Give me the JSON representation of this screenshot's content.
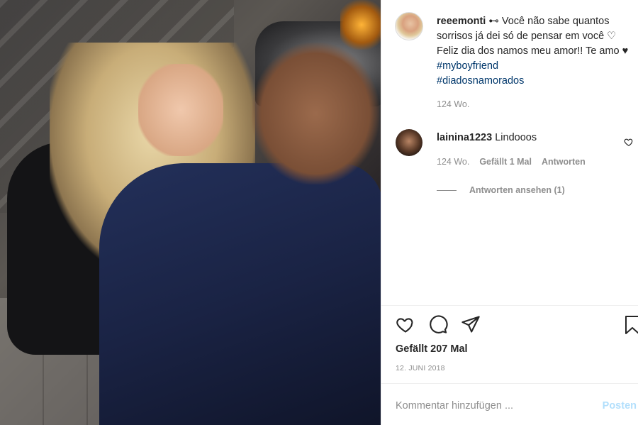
{
  "post": {
    "username": "reeemonti",
    "caption_text": "⊷ Você não sabe quantos sorrisos já dei só de pensar em você ♡ Feliz dia dos namos meu amor!! Te amo ♥ ",
    "hashtag_1": "#myboyfriend",
    "hashtag_2": "#diadosnamorados",
    "time_ago": "124 Wo."
  },
  "comment": {
    "username": "lainina1223",
    "text": "Lindooos",
    "time_ago": "124 Wo.",
    "likes_label": "Gefällt 1 Mal",
    "reply_label": "Antworten",
    "view_replies_label": "Antworten ansehen (1)"
  },
  "engagement": {
    "likes_label": "Gefällt 207 Mal",
    "date": "12. JUNI 2018"
  },
  "input": {
    "placeholder": "Kommentar hinzufügen ...",
    "post_label": "Posten"
  },
  "icons": {
    "like": "heart-icon",
    "comment": "comment-icon",
    "share": "share-icon",
    "save": "bookmark-icon"
  },
  "colors": {
    "hashtag": "#00376b",
    "muted": "#8e8e8e",
    "post_button": "#b2dffc"
  }
}
